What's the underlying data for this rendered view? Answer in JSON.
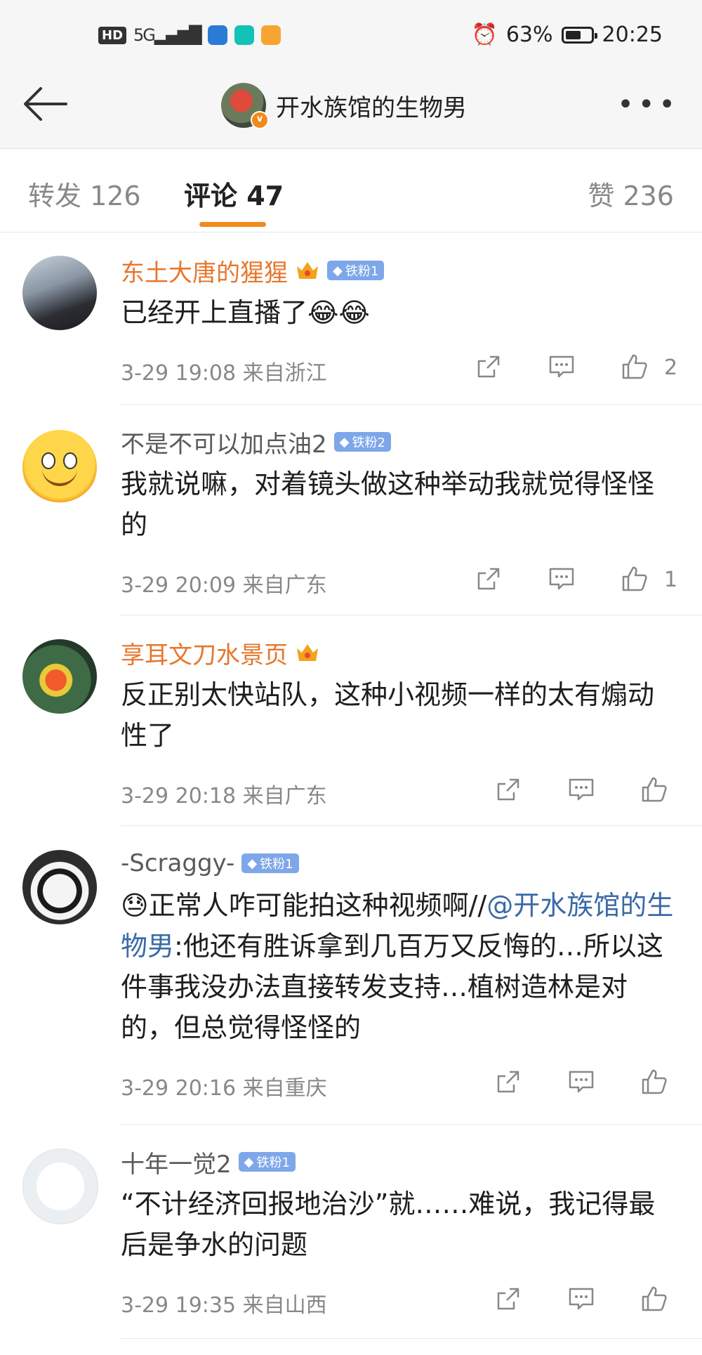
{
  "status_bar": {
    "hd": "HD",
    "signal": "5G",
    "battery_percent": "63%",
    "time": "20:25",
    "battery_level": 0.63
  },
  "nav": {
    "title": "开水族馆的生物男",
    "verified_badge": "v",
    "more": "•••"
  },
  "tabs": {
    "repost": "转发 126",
    "comments": "评论 47",
    "likes": "赞 236"
  },
  "comments": [
    {
      "username": "东土大唐的猩猩",
      "badge": "铁粉1",
      "has_crown": true,
      "text": "已经开上直播了😂😂",
      "time": "3-29 19:08 来自浙江",
      "likes": "2"
    },
    {
      "username": "不是不可以加点油2",
      "badge": "铁粉2",
      "has_crown": false,
      "text": "我就说嘛，对着镜头做这种举动我就觉得怪怪的",
      "time": "3-29 20:09 来自广东",
      "likes": "1"
    },
    {
      "username": "享耳文刀水景页",
      "badge": "",
      "has_crown": true,
      "text": "反正别太快站队，这种小视频一样的太有煽动性了",
      "time": "3-29 20:18 来自广东",
      "likes": ""
    },
    {
      "username": "-Scraggy-",
      "badge": "铁粉1",
      "has_crown": false,
      "text_prefix": "😓正常人咋可能拍这种视频啊//",
      "mention": "@开水族馆的生物男",
      "text_suffix": ":他还有胜诉拿到几百万又反悔的…所以这件事我没办法直接转发支持…植树造林是对的，但总觉得怪怪的",
      "time": "3-29 20:16 来自重庆",
      "likes": ""
    },
    {
      "username": "十年一觉2",
      "badge": "铁粉1",
      "has_crown": false,
      "text": "“不计经济回报地治沙”就……难说，我记得最后是争水的问题",
      "time": "3-29 19:35 来自山西",
      "likes": ""
    }
  ],
  "colors": {
    "accent_orange": "#f28a1e",
    "username_orange": "#e6772c",
    "mention_blue": "#3a6aa6",
    "fan_badge_blue": "#7ea7ea"
  }
}
